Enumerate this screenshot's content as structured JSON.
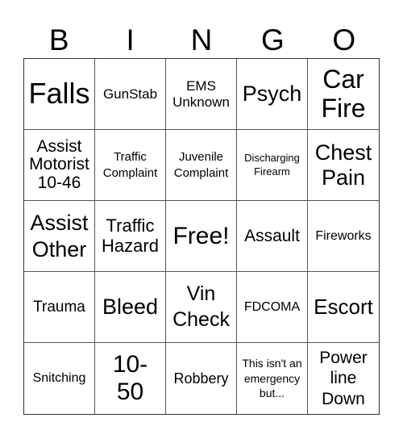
{
  "header": {
    "letters": [
      "B",
      "I",
      "N",
      "G",
      "O"
    ]
  },
  "cells": [
    {
      "text": "Falls",
      "size": "xl"
    },
    {
      "text": "GunStab",
      "size": "s"
    },
    {
      "text": "EMS Unknown",
      "size": "s"
    },
    {
      "text": "Psych",
      "size": "l"
    },
    {
      "text": "Car Fire",
      "size": "l"
    },
    {
      "text": "Assist Motorist 10-46",
      "size": "m"
    },
    {
      "text": "Traffic Complaint",
      "size": "xs"
    },
    {
      "text": "Juvenile Complaint",
      "size": "xs"
    },
    {
      "text": "Discharging Firearm",
      "size": "xxs"
    },
    {
      "text": "Chest Pain",
      "size": "l"
    },
    {
      "text": "Assist Other",
      "size": "l"
    },
    {
      "text": "Traffic Hazard",
      "size": "m"
    },
    {
      "text": "Free!",
      "size": "l",
      "free": true
    },
    {
      "text": "Assault",
      "size": "m"
    },
    {
      "text": "Fireworks",
      "size": "s"
    },
    {
      "text": "Trauma",
      "size": "m"
    },
    {
      "text": "Bleed",
      "size": "l"
    },
    {
      "text": "Vin Check",
      "size": "l"
    },
    {
      "text": "FDCOMA",
      "size": "s"
    },
    {
      "text": "Escort",
      "size": "l"
    },
    {
      "text": "Snitching",
      "size": "s"
    },
    {
      "text": "10-50",
      "size": "l"
    },
    {
      "text": "Robbery",
      "size": "m"
    },
    {
      "text": "This isn't an emergency but...",
      "size": "xxs"
    },
    {
      "text": "Power line Down",
      "size": "m"
    }
  ]
}
